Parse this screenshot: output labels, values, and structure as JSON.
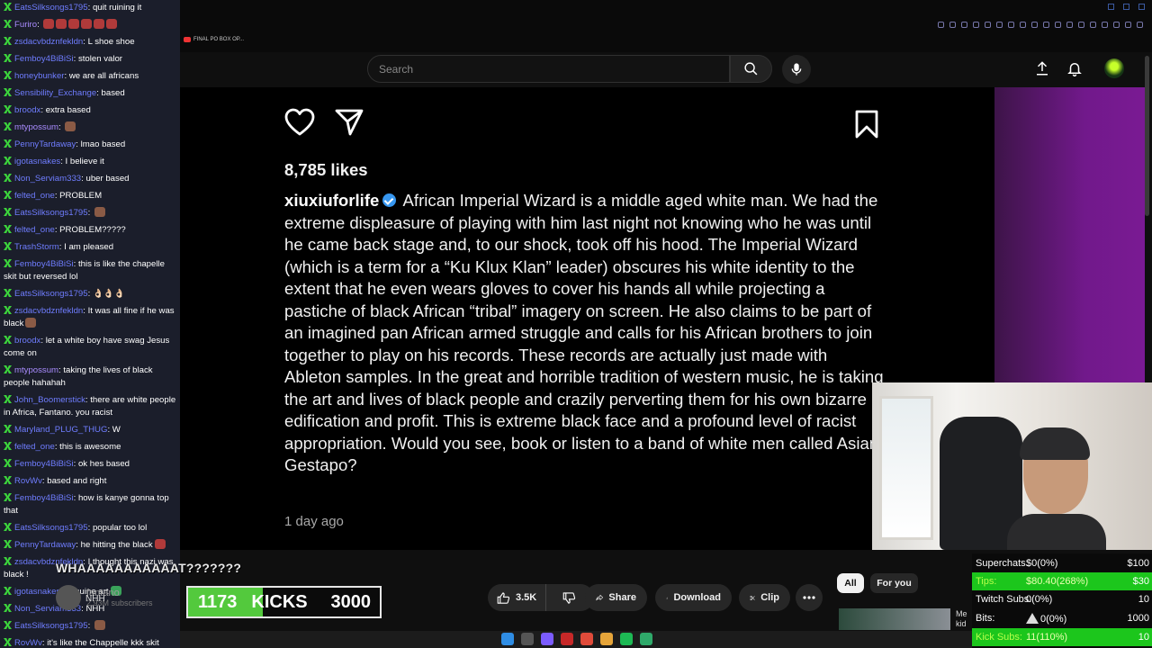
{
  "chat": [
    {
      "user": "EatsSilksongs1795",
      "text": "quit ruining it",
      "color": "blue",
      "emote": ""
    },
    {
      "user": "Furiro",
      "text": "",
      "color": "purple",
      "emote": "red6"
    },
    {
      "user": "zsdacvbdznfekldn",
      "text": "L shoe shoe",
      "color": "blue",
      "emote": ""
    },
    {
      "user": "Femboy4BiBiSi",
      "text": "stolen valor",
      "color": "blue",
      "emote": ""
    },
    {
      "user": "honeybunker",
      "text": "we are all africans",
      "color": "blue",
      "emote": ""
    },
    {
      "user": "Sensibility_Exchange",
      "text": "based",
      "color": "blue",
      "emote": ""
    },
    {
      "user": "broodx",
      "text": "extra based",
      "color": "blue",
      "emote": ""
    },
    {
      "user": "mtypossum",
      "text": "",
      "color": "purple",
      "emote": "face"
    },
    {
      "user": "PennyTardaway",
      "text": "lmao based",
      "color": "blue",
      "emote": ""
    },
    {
      "user": "igotasnakes",
      "text": "I believe it",
      "color": "blue",
      "emote": ""
    },
    {
      "user": "Non_Serviam333",
      "text": "uber based",
      "color": "blue",
      "emote": ""
    },
    {
      "user": "felted_one",
      "text": "PROBLEM",
      "color": "blue",
      "emote": ""
    },
    {
      "user": "EatsSilksongs1795",
      "text": "",
      "color": "blue",
      "emote": "face"
    },
    {
      "user": "felted_one",
      "text": "PROBLEM?????",
      "color": "blue",
      "emote": ""
    },
    {
      "user": "TrashStorm",
      "text": "I am pleased",
      "color": "blue",
      "emote": ""
    },
    {
      "user": "Femboy4BiBiSi",
      "text": "this is like the chapelle skit but reversed lol",
      "color": "blue",
      "emote": ""
    },
    {
      "user": "EatsSilksongs1795",
      "text": "👌🏻👌🏻👌🏻",
      "color": "blue",
      "emote": ""
    },
    {
      "user": "zsdacvbdznfekldn",
      "text": "It was all fine if he was black",
      "color": "blue",
      "emote": "face"
    },
    {
      "user": "broodx",
      "text": "let a white boy have swag Jesus come on",
      "color": "blue",
      "emote": ""
    },
    {
      "user": "mtypossum",
      "text": "taking the lives of black people hahahah",
      "color": "purple",
      "emote": ""
    },
    {
      "user": "John_Boomerstick",
      "text": "there are white people in Africa, Fantano. you racist",
      "color": "blue",
      "emote": ""
    },
    {
      "user": "Maryland_PLUG_THUG",
      "text": "W",
      "color": "blue",
      "emote": ""
    },
    {
      "user": "felted_one",
      "text": "this is awesome",
      "color": "blue",
      "emote": ""
    },
    {
      "user": "Femboy4BiBiSi",
      "text": "ok hes based",
      "color": "blue",
      "emote": ""
    },
    {
      "user": "RovWv",
      "text": "based and right",
      "color": "blue",
      "emote": ""
    },
    {
      "user": "Femboy4BiBiSi",
      "text": "how is kanye gonna top that",
      "color": "blue",
      "emote": ""
    },
    {
      "user": "EatsSilksongs1795",
      "text": "popular too lol",
      "color": "blue",
      "emote": ""
    },
    {
      "user": "PennyTardaway",
      "text": "he hitting the black",
      "color": "blue",
      "emote": "red"
    },
    {
      "user": "zsdacvbdznfekldn",
      "text": "I thought this nazi was black !",
      "color": "blue",
      "emote": ""
    },
    {
      "user": "igotasnakes",
      "text": "genuine art",
      "color": "blue",
      "emote": "green"
    },
    {
      "user": "Non_Serviam333",
      "text": "NHH",
      "color": "blue",
      "emote": ""
    },
    {
      "user": "EatsSilksongs1795",
      "text": "",
      "color": "blue",
      "emote": "face"
    },
    {
      "user": "RovWv",
      "text": "it's like the Chappelle kkk skit",
      "color": "blue",
      "emote": ""
    }
  ],
  "browser": {
    "tab_label": "FINAL PO BOX OP..."
  },
  "header": {
    "search_placeholder": "Search"
  },
  "post": {
    "likes": "8,785 likes",
    "handle": "xiuxiuforlife",
    "caption": "African Imperial Wizard is a middle aged white man. We had the extreme displeasure of playing with him last night not knowing who he was until he came back stage and, to our shock, took off his hood. The Imperial Wizard (which is a term for a “Ku Klux Klan” leader) obscures his white identity to the extent that he even wears gloves to cover his hands all while projecting a pastiche of black African “tribal” imagery on screen. He also claims to be part of an imagined pan African armed struggle and calls for his African brothers to join together to play on his records. These records are actually just made with Ableton samples. In the great and horrible tradition of western music, he is taking the art and lives of black people and crazily perverting them for his own bizarre edification and profit. This is extreme black face and a profound level of racist appropriation. Would you see, book or listen to a band of white men called Asian Gestapo?",
    "time_ago": "1 day ago"
  },
  "overlay": {
    "shout": "WHAAAAAAAAAAAT???????",
    "channel_name": "fantano",
    "channel_subs": "2.93M subscribers",
    "nhh": "NHH"
  },
  "kicks": {
    "current": "1173",
    "label": "KICKS",
    "goal": "3000",
    "progress": 0.391,
    "color": "#53c93d"
  },
  "actions": {
    "like_count": "3.5K",
    "share": "Share",
    "download": "Download",
    "clip": "Clip"
  },
  "filters": {
    "all": "All",
    "for_you": "For you"
  },
  "sidebar_video": {
    "title_fragment": "Me",
    "meta_fragment": "kid"
  },
  "stats": [
    {
      "key": "Superchats:",
      "value": "$0(0%)",
      "goal": "$100",
      "highlight": false
    },
    {
      "key": "Tips:",
      "value": "$80.40(268%)",
      "goal": "$30",
      "highlight": true
    },
    {
      "key": "Twitch Subs:",
      "value": "0(0%)",
      "goal": "10",
      "highlight": false
    },
    {
      "key": "Bits:",
      "value": "0(0%)",
      "goal": "1000",
      "highlight": false
    },
    {
      "key": "Kick Subs:",
      "value": "11(110%)",
      "goal": "10",
      "highlight": true
    }
  ],
  "colors": {
    "accent_green": "#1cc61c",
    "chat_bg": "#1b1e2b",
    "verified_blue": "#3797f0"
  }
}
